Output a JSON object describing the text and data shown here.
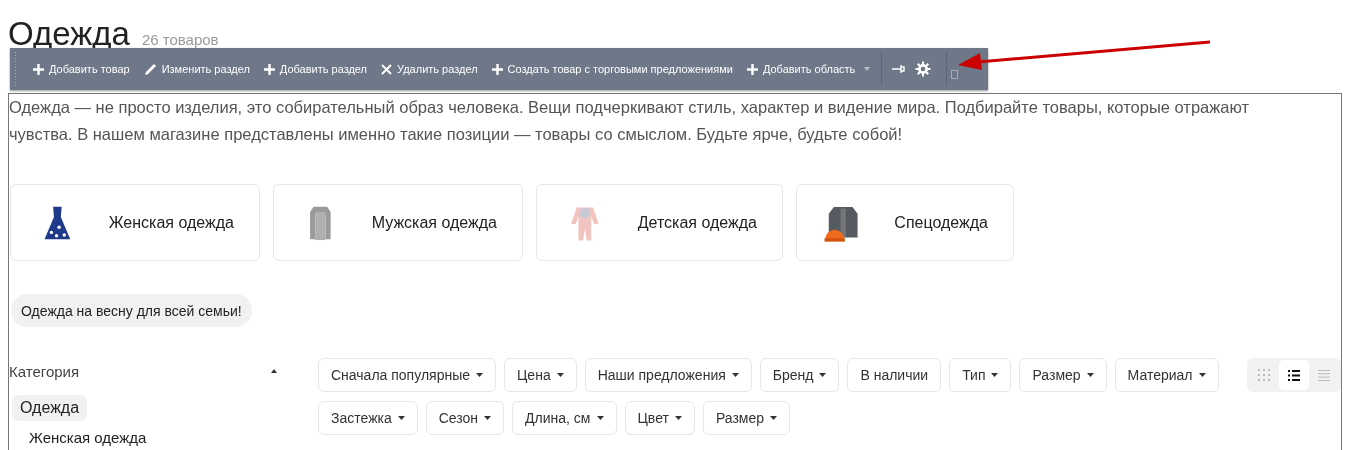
{
  "heading": {
    "title": "Одежда",
    "count": "26 товаров"
  },
  "toolbar": {
    "items": [
      {
        "kind": "plus",
        "label": "Добавить товар",
        "dropdown": false
      },
      {
        "kind": "pencil",
        "label": "Изменить раздел",
        "dropdown": false
      },
      {
        "kind": "plus",
        "label": "Добавить раздел",
        "dropdown": false
      },
      {
        "kind": "cross",
        "label": "Удалить раздел",
        "dropdown": false
      },
      {
        "kind": "plus",
        "label": "Создать товар с торговыми предложениями",
        "dropdown": false
      },
      {
        "kind": "plus",
        "label": "Добавить область",
        "dropdown": true
      }
    ]
  },
  "description": "Одежда — не просто изделия, это собирательный образ человека. Вещи подчеркивают стиль, характер и видение мира. Подбирайте товары, которые отражают чувства. В нашем магазине представлены именно такие позиции — товары со смыслом. Будьте ярче, будьте собой!",
  "categories": [
    {
      "label": "Женская одежда",
      "kind": "picture"
    },
    {
      "label": "Мужская одежда",
      "kind": "picture"
    },
    {
      "label": "Детская одежда",
      "kind": "picture"
    },
    {
      "label": "Спецодежда",
      "kind": "picture"
    }
  ],
  "tags": [
    "Одежда на весну для всей семьи!"
  ],
  "sidebar": {
    "title": "Категория",
    "expanded": true,
    "items": [
      {
        "label": "Одежда",
        "selected": true,
        "children": [
          {
            "label": "Женская одежда",
            "selected": false
          }
        ]
      }
    ]
  },
  "filters": [
    {
      "label": "Сначала популярные",
      "dropdown": true
    },
    {
      "label": "Цена",
      "dropdown": true
    },
    {
      "label": "Наши предложения",
      "dropdown": true
    },
    {
      "label": "Бренд",
      "dropdown": true
    },
    {
      "label": "В наличии",
      "dropdown": false
    },
    {
      "label": "Тип",
      "dropdown": true
    },
    {
      "label": "Размер",
      "dropdown": true
    },
    {
      "label": "Материал",
      "dropdown": true
    },
    {
      "label": "Застежка",
      "dropdown": true
    },
    {
      "label": "Сезон",
      "dropdown": true
    },
    {
      "label": "Длина, см",
      "dropdown": true
    },
    {
      "label": "Цвет",
      "dropdown": true
    },
    {
      "label": "Размер",
      "dropdown": true
    }
  ],
  "view_modes": [
    {
      "kind": "grid",
      "selected": false
    },
    {
      "kind": "list",
      "selected": true
    },
    {
      "kind": "lines",
      "selected": false
    }
  ]
}
